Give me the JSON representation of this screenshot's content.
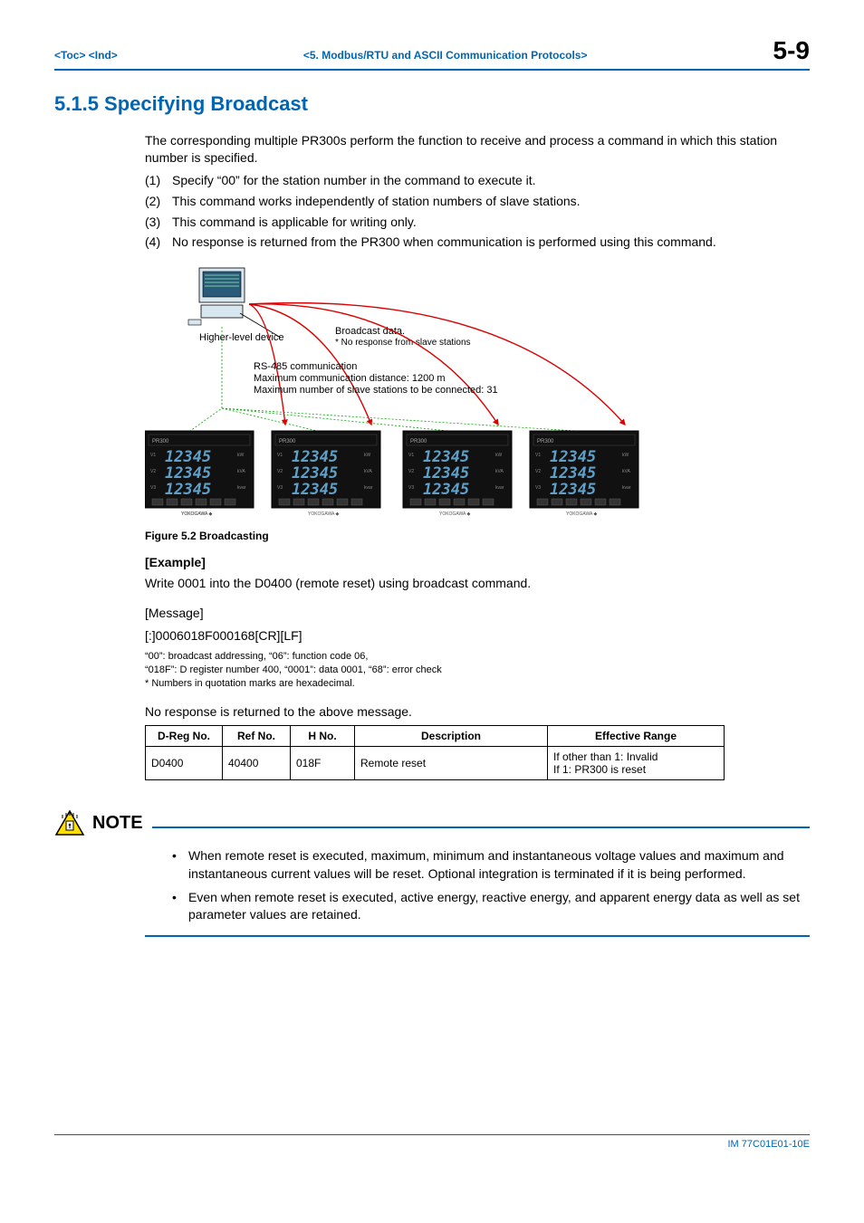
{
  "header": {
    "left": "<Toc> <Ind>",
    "mid": "<5.  Modbus/RTU and ASCII Communication Protocols>",
    "right": "5-9"
  },
  "section": {
    "number_title": "5.1.5    Specifying Broadcast",
    "intro": "The corresponding multiple PR300s perform the function to receive and process a command in which this station number is specified.",
    "items": [
      {
        "n": "(1)",
        "t": "Specify “00” for the station number in the command to execute it."
      },
      {
        "n": "(2)",
        "t": "This command works independently of station numbers of slave stations."
      },
      {
        "n": "(3)",
        "t": "This command is applicable for writing only."
      },
      {
        "n": "(4)",
        "t": "No response is returned from the PR300 when communication is performed using this command."
      }
    ]
  },
  "figure": {
    "higher_level": "Higher-level device",
    "broadcast_line1": "Broadcast data.",
    "broadcast_line2": "* No response from slave stations",
    "rs485_l1": "RS-485 communication",
    "rs485_l2": "Maximum communication distance: 1200 m",
    "rs485_l3": "Maximum number of slave stations to be connected: 31",
    "device_digits": "12345",
    "caption": "Figure 5.2  Broadcasting"
  },
  "example": {
    "heading": "[Example]",
    "sentence": "Write 0001 into the D0400 (remote reset) using broadcast command.",
    "msg_label": "[Message]",
    "msg": "[:]0006018F000168[CR][LF]",
    "notes_l1": "“00”: broadcast addressing, “06”: function code 06,",
    "notes_l2": "“018F”: D register number 400, “0001”: data 0001, “68”: error check",
    "notes_l3": "* Numbers in quotation marks are hexadecimal.",
    "noresp": "No response is returned to the above message."
  },
  "table": {
    "headers": [
      "D-Reg No.",
      "Ref No.",
      "H No.",
      "Description",
      "Effective Range"
    ],
    "rows": [
      {
        "dreg": "D0400",
        "ref": "40400",
        "hno": "018F",
        "desc": "Remote reset",
        "range_l1": "If other than 1: Invalid",
        "range_l2": "If 1: PR300 is reset"
      }
    ]
  },
  "note": {
    "title": "NOTE",
    "bullets": [
      "When remote reset is executed, maximum, minimum and instantaneous voltage values and maximum and instantaneous current values will be reset. Optional integration is terminated if it is being performed.",
      "Even when remote reset is executed, active energy, reactive energy, and apparent energy data as well as set parameter values are retained."
    ]
  },
  "footer": "IM 77C01E01-10E",
  "chart_data": {
    "type": "table",
    "title": "D-register for remote reset (broadcast example)",
    "columns": [
      "D-Reg No.",
      "Ref No.",
      "H No.",
      "Description",
      "Effective Range"
    ],
    "rows": [
      [
        "D0400",
        "40400",
        "018F",
        "Remote reset",
        "If other than 1: Invalid; If 1: PR300 is reset"
      ]
    ]
  }
}
